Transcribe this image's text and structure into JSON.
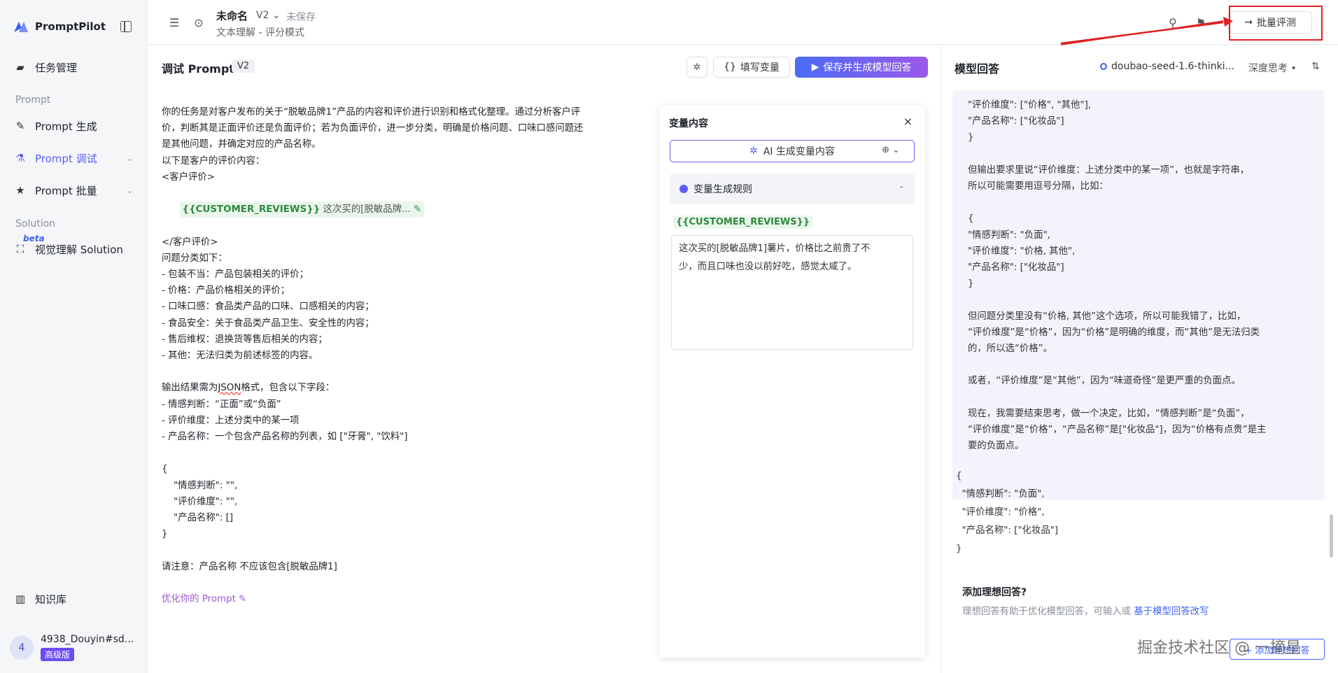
{
  "sidebar": {
    "brand": "PromptPilot",
    "items": [
      {
        "label": "任务管理"
      },
      {
        "label": "Prompt 生成"
      },
      {
        "label": "Prompt 调试"
      },
      {
        "label": "Prompt 批量"
      },
      {
        "label": "视觉理解 Solution"
      },
      {
        "label": "知识库"
      }
    ],
    "section_prompt": "Prompt",
    "section_solution": "Solution",
    "beta": "beta",
    "user": {
      "avatar": "4",
      "name": "4938_Douyin#sd...",
      "badge": "高级版"
    }
  },
  "topbar": {
    "title": "未命名",
    "version": "V2",
    "unsaved": "未保存",
    "subtitle": "文本理解 - 评分模式",
    "batch_label": "批量评测"
  },
  "editor": {
    "title": "调试 Prompt",
    "version": "V2",
    "fill_label": "填写变量",
    "save_label": "保存并生成模型回答",
    "lines": [
      "你的任务是对客户发布的关于“脱敏品牌1”产品的内容和评价进行识别和格式化整理。通过分析客户评",
      "价，判断其是正面评价还是负面评价；若为负面评价，进一步分类，明确是价格问题、口味口感问题还",
      "是其他问题，并确定对应的产品名称。",
      "以下是客户的评价内容：",
      "<客户评价>"
    ],
    "var_name": "{{CUSTOMER_REVIEWS}}",
    "var_preview": "这次买的[脱敏品牌...",
    "lines2": [
      "</客户评价>",
      "问题分类如下：",
      "- 包装不当：产品包装相关的评价；",
      "- 价格：产品价格相关的评价；",
      "- 口味口感：食品类产品的口味、口感相关的内容；",
      "- 食品安全：关于食品类产品卫生、安全性的内容；",
      "- 售后维权：退换货等售后相关的内容；",
      "- 其他：无法归类为前述标签的内容。",
      ""
    ],
    "json_line_pre": "输出结果需为",
    "json_word": "JSON",
    "json_line_post": "格式，包含以下字段：",
    "lines3": [
      "- 情感判断：“正面”或“负面”",
      "- 评价维度：上述分类中的某一项",
      "- 产品名称：一个包含产品名称的列表，如 [\"牙膏\", \"饮料\"]",
      "",
      "{",
      "    \"情感判断\": \"\",",
      "    \"评价维度\": \"\",",
      "    \"产品名称\": []",
      "}",
      "",
      "请注意：产品名称 不应该包含[脱敏品牌1]",
      ""
    ],
    "optimize_label": "优化你的 Prompt ✎"
  },
  "variables": {
    "title": "变量内容",
    "ai_gen_label": "AI 生成变量内容",
    "rule_label": "变量生成规则",
    "var_name": "{{CUSTOMER_REVIEWS}}",
    "var_value_lines": [
      "这次买的[脱敏品牌1]薯片，价格比之前贵了不",
      "少，而且口味也没以前好吃，感觉太咸了。"
    ]
  },
  "response": {
    "title": "模型回答",
    "model": "doubao-seed-1.6-thinki...",
    "deep_think": "深度思考 •",
    "think_lines": [
      "\"评价维度\": [\"价格\", \"其他\"],",
      "\"产品名称\": [\"化妆品\"]",
      "}",
      "",
      "但输出要求里说“评价维度：上述分类中的某一项”，也就是字符串，",
      "所以可能需要用逗号分隔，比如：",
      "",
      "{",
      "\"情感判断\": \"负面\",",
      "\"评价维度\": \"价格, 其他\",",
      "\"产品名称\": [\"化妆品\"]",
      "}",
      "",
      "但问题分类里没有“价格, 其他”这个选项，所以可能我错了，比如，",
      "“评价维度”是“价格”，因为“价格”是明确的维度，而“其他”是无法归类",
      "的，所以选“价格”。",
      "",
      "或者，“评价维度”是“其他”，因为“味道奇怪”是更严重的负面点。",
      "",
      "现在，我需要结束思考，做一个决定，比如，“情感判断”是“负面”，",
      "“评价维度”是“价格”，“产品名称”是[\"化妆品\"]，因为“价格有点贵”是主",
      "要的负面点。"
    ],
    "answer_lines": [
      "{",
      "  \"情感判断\": \"负面\",",
      "  \"评价维度\": \"价格\",",
      "  \"产品名称\": [\"化妆品\"]",
      "}"
    ],
    "ideal_title": "添加理想回答?",
    "ideal_sub": "理想回答有助于优化模型回答，可输入或 ",
    "ideal_link": "基于模型回答改写",
    "watermark": "掘金技术社区 @ 一摘星",
    "add_label": "+ 添加理想回答"
  }
}
